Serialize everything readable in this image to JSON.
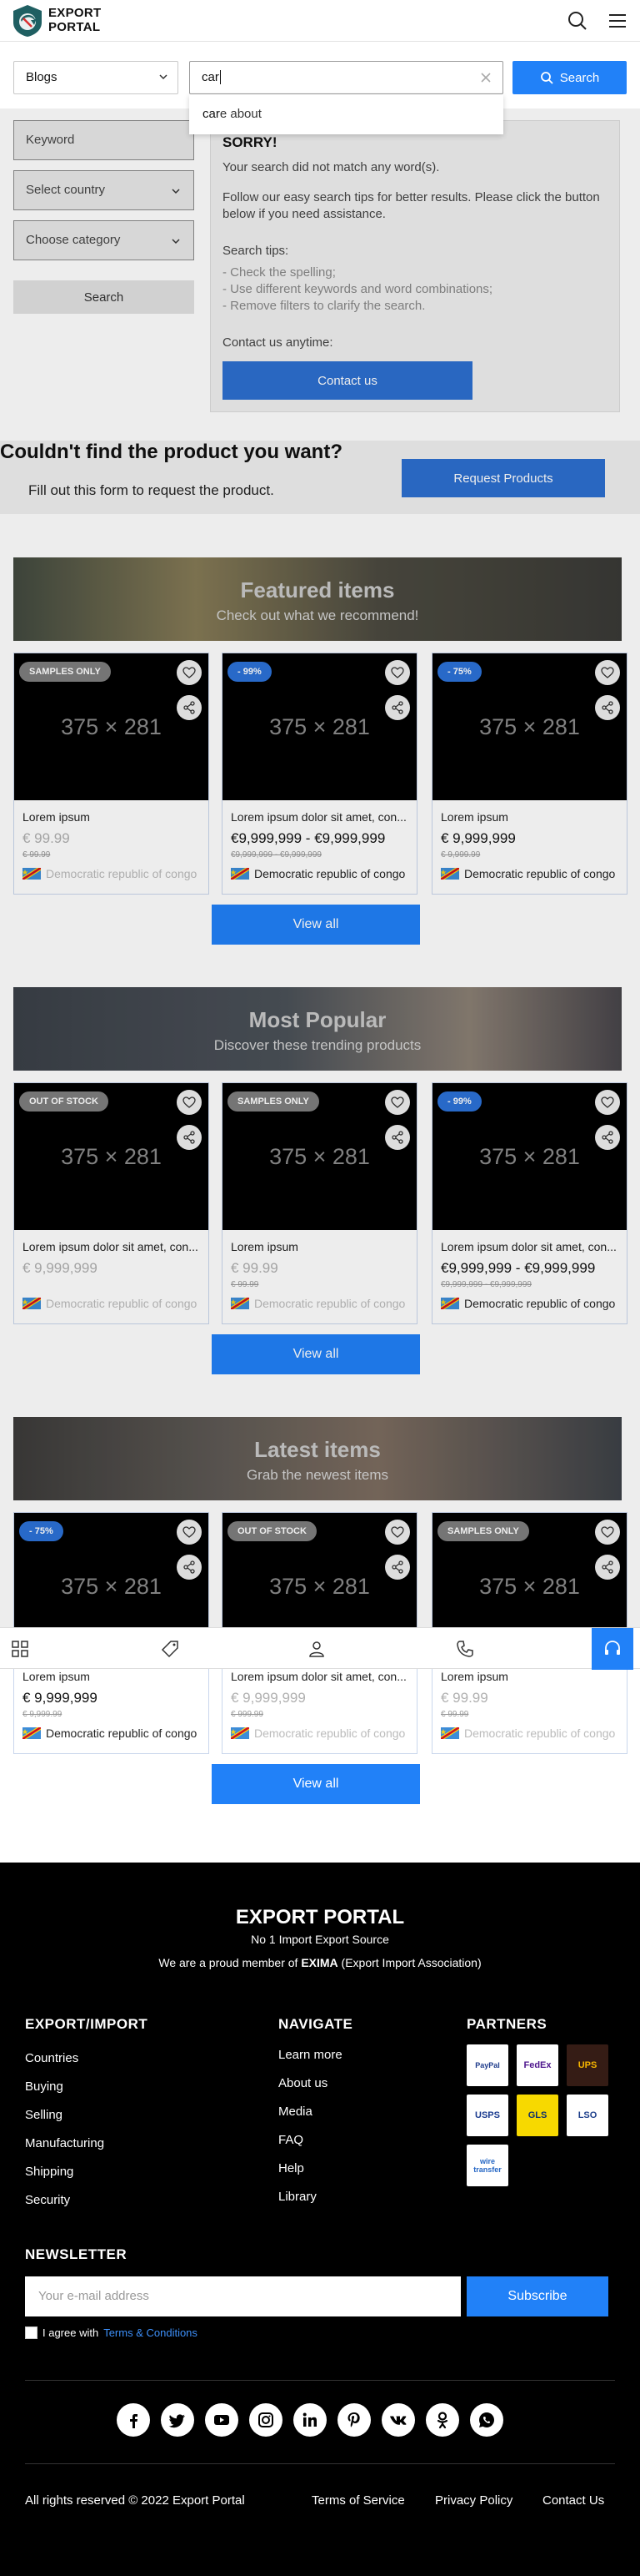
{
  "header": {
    "logo_line1": "EXPORT",
    "logo_line2": "PORTAL",
    "icons": [
      "search-icon",
      "menu-icon"
    ]
  },
  "search": {
    "type_selected": "Blogs",
    "query": "car",
    "suggestion_prefix": "car",
    "suggestion_rest": "e about",
    "button_label": "Search"
  },
  "filters": {
    "keyword_placeholder": "Keyword",
    "country_placeholder": "Select country",
    "category_placeholder": "Choose category",
    "search_button": "Search"
  },
  "no_results": {
    "title": "SORRY!",
    "message": "Your search did not match any word(s).",
    "advice": "Follow our easy search tips for better results. Please click the button below if you need assistance.",
    "tips_title": "Search tips:",
    "tips": [
      "- Check the spelling;",
      "- Use different keywords and word combinations;",
      "- Remove filters to clarify the search."
    ],
    "contact_label": "Contact us anytime:",
    "contact_button": "Contact us"
  },
  "request": {
    "title": "Couldn't find the product you want?",
    "subtitle": "Fill out this form to request the product.",
    "button": "Request Products"
  },
  "sections": [
    {
      "title": "Featured items",
      "subtitle": "Check out what we recommend!",
      "view_all": "View all",
      "items": [
        {
          "badge": "SAMPLES ONLY",
          "badge_style": "grey",
          "image_text": "375 × 281",
          "name": "Lorem ipsum",
          "price": "€ 99.99",
          "old_price": "€ 99.99",
          "country": "Democratic republic of congo",
          "faded": true
        },
        {
          "badge": "- 99%",
          "badge_style": "blue",
          "image_text": "375 × 281",
          "name": "Lorem ipsum dolor sit amet, con...",
          "price": "€9,999,999 - €9,999,999",
          "old_price": "€9,999,999 - €9,999,999",
          "country": "Democratic republic of congo",
          "faded": false
        },
        {
          "badge": "- 75%",
          "badge_style": "blue",
          "image_text": "375 × 281",
          "name": "Lorem ipsum",
          "price": "€ 9,999,999",
          "old_price": "€ 9,999.99",
          "country": "Democratic republic of congo",
          "faded": false
        }
      ]
    },
    {
      "title": "Most Popular",
      "subtitle": "Discover these trending products",
      "view_all": "View all",
      "items": [
        {
          "badge": "OUT OF STOCK",
          "badge_style": "grey",
          "image_text": "375 × 281",
          "name": "Lorem ipsum dolor sit amet, con...",
          "price": "€ 9,999,999",
          "old_price": "",
          "country": "Democratic republic of congo",
          "faded": true
        },
        {
          "badge": "SAMPLES ONLY",
          "badge_style": "grey",
          "image_text": "375 × 281",
          "name": "Lorem ipsum",
          "price": "€ 99.99",
          "old_price": "€ 99.99",
          "country": "Democratic republic of congo",
          "faded": true
        },
        {
          "badge": "- 99%",
          "badge_style": "blue",
          "image_text": "375 × 281",
          "name": "Lorem ipsum dolor sit amet, con...",
          "price": "€9,999,999 - €9,999,999",
          "old_price": "€9,999,999 - €9,999,999",
          "country": "Democratic republic of congo",
          "faded": false
        }
      ]
    },
    {
      "title": "Latest items",
      "subtitle": "Grab the newest items",
      "view_all": "View all",
      "items": [
        {
          "badge": "- 75%",
          "badge_style": "blue",
          "image_text": "375 × 281",
          "name": "Lorem ipsum",
          "price": "€ 9,999,999",
          "old_price": "€ 9,999.99",
          "country": "Democratic republic of congo",
          "faded": false
        },
        {
          "badge": "OUT OF STOCK",
          "badge_style": "grey",
          "image_text": "375 × 281",
          "name": "Lorem ipsum dolor sit amet, con...",
          "price": "€ 9,999,999",
          "old_price": "€ 999.99",
          "country": "Democratic republic of congo",
          "faded": true
        },
        {
          "badge": "SAMPLES ONLY",
          "badge_style": "grey",
          "image_text": "375 × 281",
          "name": "Lorem ipsum",
          "price": "€ 99.99",
          "old_price": "€ 99.99",
          "country": "Democratic republic of congo",
          "faded": true
        }
      ]
    }
  ],
  "bottom_nav": {
    "icons": [
      "categories-icon",
      "tag-icon",
      "user-icon",
      "phone-icon",
      "headset-icon"
    ]
  },
  "footer": {
    "brand": "EXPORT PORTAL",
    "slogan": "No 1 Import Export Source",
    "member_prefix": "We are a proud member of ",
    "member_org": "EXIMA",
    "member_suffix": " (Export Import Association)",
    "col1_title": "EXPORT/IMPORT",
    "col1_links": [
      "Countries",
      "Buying",
      "Selling",
      "Manufacturing",
      "Shipping",
      "Security"
    ],
    "col2_title": "NAVIGATE",
    "col2_links": [
      "Learn more",
      "About us",
      "Media",
      "FAQ",
      "Help",
      "Library"
    ],
    "col3_title": "PARTNERS",
    "partners": [
      "PayPal",
      "FedEx",
      "UPS",
      "USPS",
      "GLS",
      "LSO",
      "wire transfer"
    ],
    "newsletter_title": "NEWSLETTER",
    "email_placeholder": "Your e-mail address",
    "subscribe": "Subscribe",
    "agree_prefix": "I agree with ",
    "agree_link": "Terms & Conditions",
    "social": [
      "facebook-icon",
      "twitter-icon",
      "youtube-icon",
      "instagram-icon",
      "linkedin-icon",
      "pinterest-icon",
      "vk-icon",
      "odnoklassniki-icon",
      "whatsapp-icon"
    ],
    "copyright": "All rights reserved © 2022 Export Portal",
    "legal": [
      "Terms of Service",
      "Privacy Policy",
      "Contact Us"
    ]
  },
  "colors": {
    "accent": "#2181f8",
    "accent_dark": "#2d6fd0",
    "footer_bg": "#000000"
  }
}
